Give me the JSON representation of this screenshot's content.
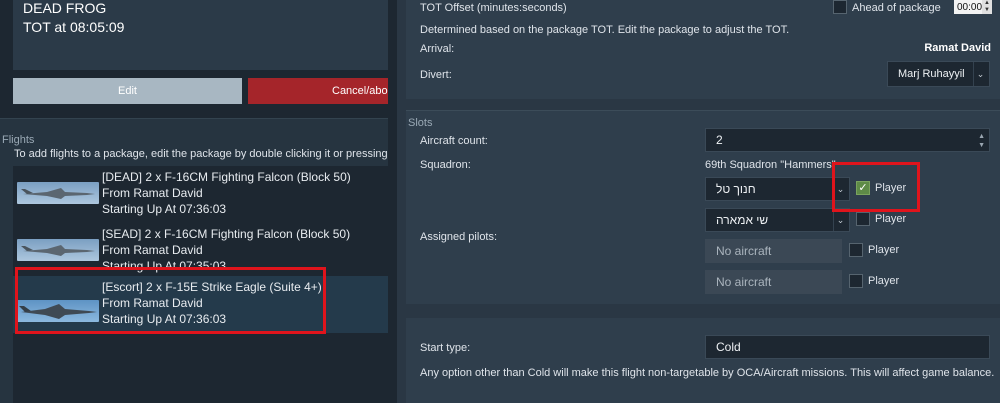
{
  "package": {
    "name": "DEAD FROG",
    "tot": "TOT at 08:05:09"
  },
  "buttons": {
    "edit": "Edit",
    "cancel": "Cancel/abo"
  },
  "flights": {
    "title": "Flights",
    "hint": "To add flights to a package, edit the package by double clicking it or pressing th",
    "items": [
      {
        "line1": "[DEAD] 2 x F-16CM Fighting Falcon (Block 50)",
        "line2": "From Ramat David",
        "line3": "Starting Up At 07:36:03"
      },
      {
        "line1": "[SEAD] 2 x F-16CM Fighting Falcon (Block 50)",
        "line2": "From Ramat David",
        "line3": "Starting Up At 07:35:03"
      },
      {
        "line1": "[Escort] 2 x F-15E Strike Eagle (Suite 4+)",
        "line2": "From Ramat David",
        "line3": "Starting Up At 07:36:03"
      }
    ]
  },
  "timing": {
    "tot_offset_label": "TOT Offset (minutes:seconds)",
    "ahead_label": "Ahead of package",
    "offset_value": "00:00",
    "determined_text": "Determined based on the package TOT. Edit the package to adjust the TOT.",
    "arrival_label": "Arrival:",
    "arrival_value": "Ramat David",
    "divert_label": "Divert:",
    "divert_value": "Marj Ruhayyil"
  },
  "slots": {
    "title": "Slots",
    "aircraft_count_label": "Aircraft count:",
    "aircraft_count_value": "2",
    "squadron_label": "Squadron:",
    "squadron_value": "69th Squadron \"Hammers\"",
    "assigned_pilots_label": "Assigned pilots:",
    "pilots": [
      {
        "name": "חנוך טל",
        "player_label": "Player",
        "player_checked": true
      },
      {
        "name": "שי אמארה",
        "player_label": "Player",
        "player_checked": false
      },
      {
        "name": "No aircraft",
        "player_label": "Player",
        "player_checked": false
      },
      {
        "name": "No aircraft",
        "player_label": "Player",
        "player_checked": false
      }
    ]
  },
  "start": {
    "label": "Start type:",
    "value": "Cold",
    "note": "Any option other than Cold will make this flight non-targetable by OCA/Aircraft missions. This will affect game balance."
  },
  "colors": {
    "highlight": "#e0141c",
    "cancel_button": "#a5252a",
    "edit_button": "#a8b7c2",
    "checkbox_checked": "#5e8b47"
  }
}
